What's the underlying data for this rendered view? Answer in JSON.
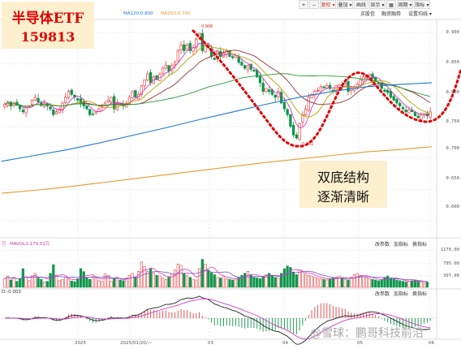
{
  "toolbar": {
    "items": [
      "+",
      "−",
      "复权 ▾",
      "叠加 ▾",
      "画线",
      "显示 ▾",
      "▦",
      "周期 ▾",
      "指标 ▾"
    ],
    "sub_items": [
      "买股信",
      "融资融券",
      "设置均线 ▾"
    ],
    "ma_labels": [
      {
        "text": "MA120:0.800",
        "color": "#1e78d6"
      },
      {
        "text": "MA250:0.700",
        "color": "#e89a2c"
      }
    ]
  },
  "title": {
    "line1": "半导体ETF",
    "line2": "159813"
  },
  "annotation": {
    "line1": "双底结构",
    "line2": "逐渐清晰"
  },
  "price_markers": {
    "high": "0.906",
    "low": "0.702"
  },
  "y_axis_price": [
    "0.900",
    "0.850",
    "0.800",
    "0.750",
    "0.700",
    "0.650",
    "0.600"
  ],
  "y_axis_volume": [
    "1170.00",
    "795.00",
    "397.00"
  ],
  "x_axis": [
    "2025",
    "2025/01/20/—",
    "03",
    "04",
    "05",
    "06"
  ],
  "volume_panel": {
    "label_prefix": "万",
    "ma_label": "MAVOL2:179.01万",
    "controls": [
      "改参数",
      "加指标",
      "换指标"
    ]
  },
  "macd_panel": {
    "label": "D:-0.003",
    "controls": [
      "改参数",
      "加指标",
      "换指标"
    ]
  },
  "watermark": "@雪球：鹏哥科技前沿",
  "colors": {
    "up": "#e84545",
    "down": "#11964a",
    "ma120": "#1e78d6",
    "ma250": "#e89a2c",
    "annotation_curve": "#e00000",
    "title_bg": "#fdf0cf"
  },
  "chart_data": {
    "type": "candlestick",
    "y_range": [
      0.6,
      0.9
    ],
    "closes": [
      0.778,
      0.782,
      0.775,
      0.78,
      0.776,
      0.77,
      0.765,
      0.772,
      0.775,
      0.785,
      0.79,
      0.782,
      0.776,
      0.78,
      0.775,
      0.77,
      0.76,
      0.765,
      0.77,
      0.78,
      0.79,
      0.8,
      0.795,
      0.79,
      0.785,
      0.78,
      0.775,
      0.77,
      0.76,
      0.76,
      0.765,
      0.77,
      0.775,
      0.78,
      0.785,
      0.79,
      0.77,
      0.78,
      0.778,
      0.775,
      0.78,
      0.79,
      0.8,
      0.79,
      0.795,
      0.81,
      0.82,
      0.83,
      0.815,
      0.825,
      0.82,
      0.83,
      0.84,
      0.845,
      0.835,
      0.845,
      0.85,
      0.87,
      0.88,
      0.87,
      0.88,
      0.87,
      0.875,
      0.89,
      0.9,
      0.87,
      0.88,
      0.875,
      0.86,
      0.855,
      0.87,
      0.86,
      0.865,
      0.87,
      0.86,
      0.858,
      0.862,
      0.85,
      0.845,
      0.84,
      0.845,
      0.838,
      0.835,
      0.825,
      0.815,
      0.8,
      0.805,
      0.8,
      0.795,
      0.79,
      0.8,
      0.78,
      0.77,
      0.76,
      0.74,
      0.725,
      0.72,
      0.745,
      0.76,
      0.77,
      0.79,
      0.795,
      0.8,
      0.802,
      0.808,
      0.806,
      0.81,
      0.805,
      0.8,
      0.81,
      0.812,
      0.81,
      0.815,
      0.8,
      0.805,
      0.808,
      0.812,
      0.82,
      0.825,
      0.828,
      0.83,
      0.822,
      0.818,
      0.815,
      0.805,
      0.8,
      0.798,
      0.79,
      0.785,
      0.78,
      0.775,
      0.77,
      0.765,
      0.768,
      0.765,
      0.758,
      0.755,
      0.76,
      0.762,
      0.758,
      0.765
    ],
    "ma120": [
      0.68,
      0.69,
      0.7,
      0.712,
      0.725,
      0.738,
      0.752,
      0.765,
      0.778,
      0.79,
      0.8,
      0.808,
      0.812,
      0.815
    ],
    "ma250": [
      0.625,
      0.63,
      0.636,
      0.643,
      0.65,
      0.657,
      0.664,
      0.671,
      0.678,
      0.684,
      0.69,
      0.696,
      0.7,
      0.705
    ],
    "volumes": [
      260,
      340,
      220,
      300,
      180,
      250,
      560,
      300,
      200,
      340,
      420,
      280,
      240,
      160,
      180,
      420,
      680,
      360,
      200,
      240,
      300,
      260,
      190,
      170,
      260,
      560,
      470,
      300,
      240,
      320,
      280,
      200,
      180,
      400,
      360,
      180,
      260,
      300,
      220,
      200,
      280,
      360,
      420,
      300,
      480,
      760,
      620,
      480,
      560,
      420,
      360,
      340,
      280,
      240,
      320,
      400,
      520,
      700,
      660,
      420,
      360,
      300,
      240,
      220,
      560,
      840,
      700,
      520,
      440,
      380,
      300,
      280,
      340,
      260,
      240,
      220,
      260,
      300,
      360,
      420,
      480,
      360,
      300,
      280,
      260,
      320,
      380,
      420,
      360,
      300,
      280,
      420,
      560,
      640,
      600,
      460,
      380,
      520,
      480,
      400,
      360,
      340,
      300,
      280,
      260,
      240,
      220,
      260,
      280,
      300,
      340,
      280,
      240,
      220,
      300,
      380,
      420,
      360,
      320,
      300,
      260,
      240,
      220,
      200,
      240,
      300,
      340,
      280,
      240,
      220,
      200,
      180,
      160,
      180,
      200,
      220,
      180,
      160,
      140,
      160
    ]
  }
}
